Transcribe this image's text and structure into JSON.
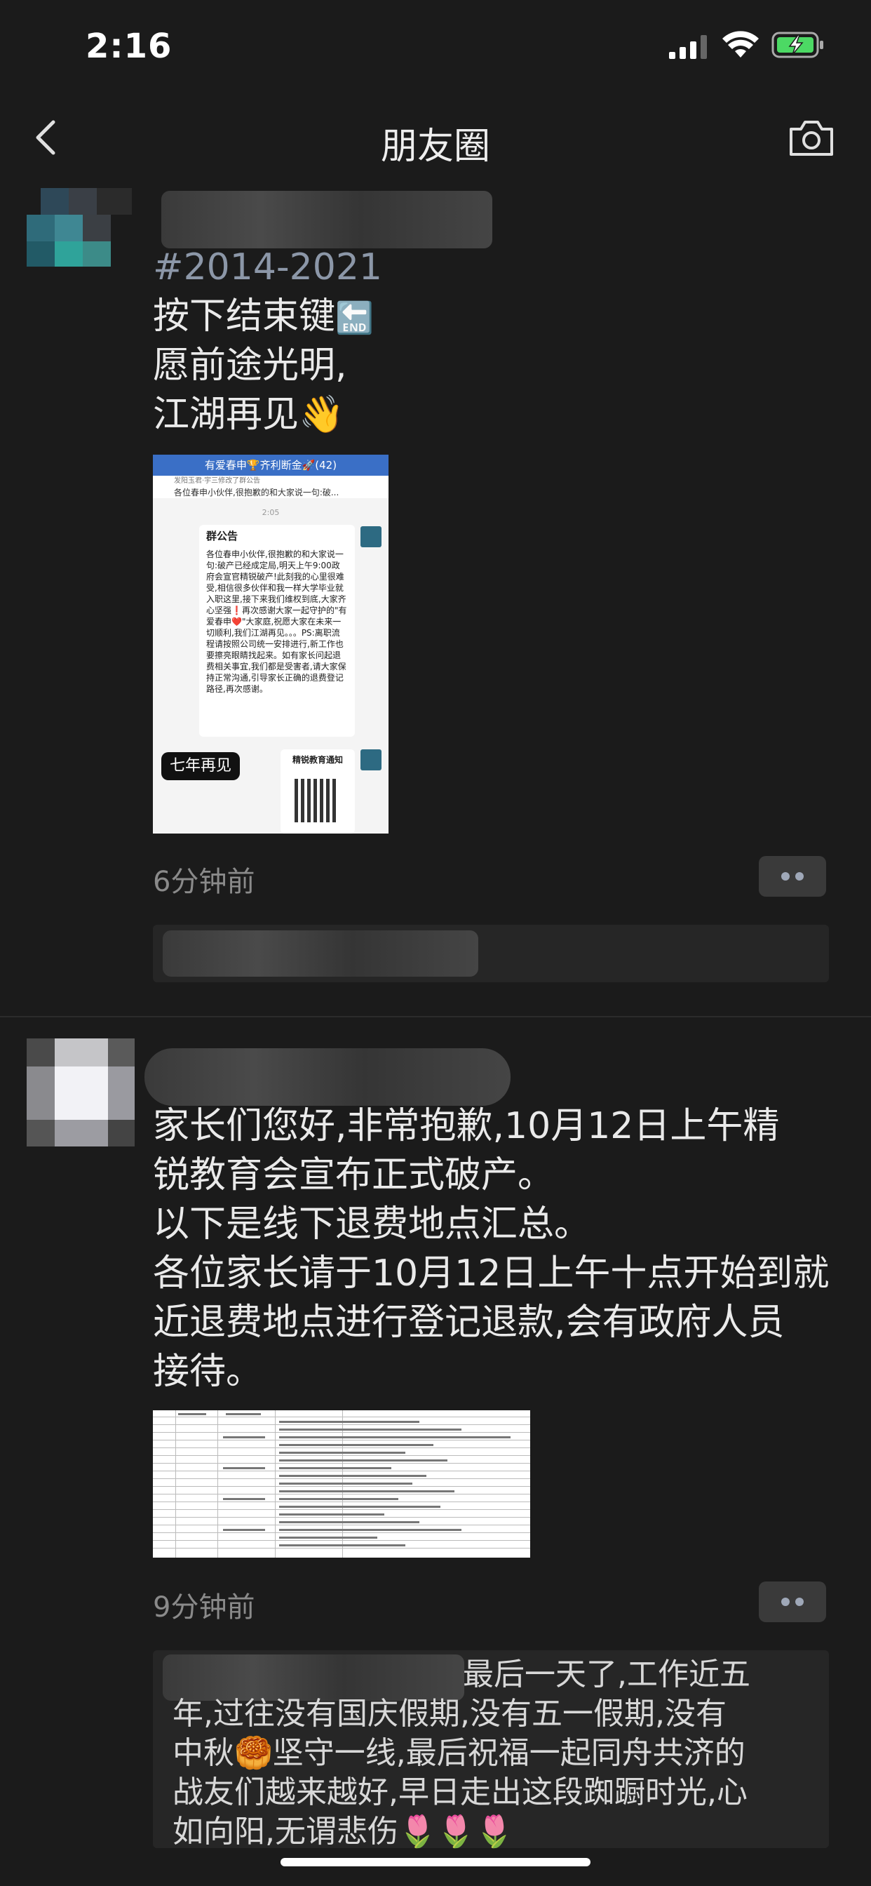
{
  "status_bar": {
    "time": "2:16"
  },
  "nav": {
    "title": "朋友圈"
  },
  "post1": {
    "text_hashtag": "#2014-2021",
    "text_line1": "按下结束键",
    "text_line1_emoji": "🔚",
    "text_line2": "愿前途光明,",
    "text_line3": "江湖再见",
    "text_line3_emoji": "👋",
    "image": {
      "header_title": "有爱春申🏆齐利断金🚀(42)",
      "notice_by": "发阳玉君·宇三修改了群公告",
      "notice_preview": "各位春申小伙伴,很抱歉的和大家说一句:破...",
      "timestamp": "2:05",
      "bubble_title": "群公告",
      "bubble_body": "各位春申小伙伴,很抱歉的和大家说一句:破产已经成定局,明天上午9:00政府会宣官精锐破产!此刻我的心里很难受,相信很多伙伴和我一样大学毕业就入职这里,接下来我们维权到底,大家齐心坚强❗再次感谢大家一起守护的\"有爱春申❤️\"大家庭,祝愿大家在未来一切顺利,我们江湖再见。。。PS:离职流程请按照公司统一安排进行,新工作也要擦亮眼睛找起来。如有家长问起退费相关事宜,我们都是受害者,请大家保持正常沟通,引导家长正确的退费登记路径,再次感谢。",
      "qr_title": "精锐教育通知",
      "tag": "七年再见"
    },
    "time": "6分钟前"
  },
  "post2": {
    "text": "家长们您好,非常抱歉,10月12日上午精锐教育会宣布正式破产。\n以下是线下退费地点汇总。\n各位家长请于10月12日上午十点开始到就近退费地点进行登记退款,会有政府人员接待。",
    "text_lines": [
      "家长们您好,非常抱歉,10月12日上午精",
      "锐教育会宣布正式破产。",
      "以下是线下退费地点汇总。",
      "各位家长请于10月12日上午十点开始到就",
      "近退费地点进行登记退款,会有政府人员",
      "接待。"
    ],
    "time": "9分钟前",
    "comment_lines": [
      "最后一天了,工作近五",
      "年,过往没有国庆假期,没有五一假期,没有",
      "中秋🥮坚守一线,最后祝福一起同舟共济的",
      "战友们越来越好,早日走出这段踟蹰时光,心",
      "如向阳,无谓悲伤🌷🌷🌷"
    ]
  }
}
